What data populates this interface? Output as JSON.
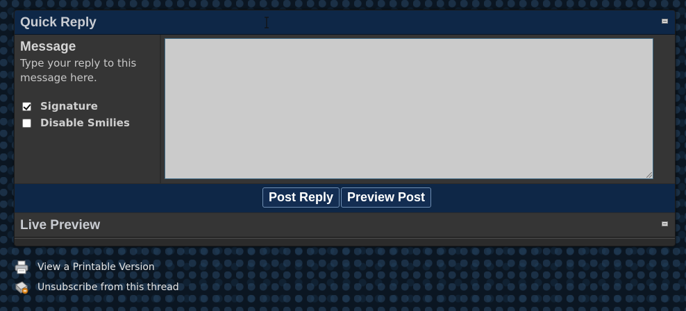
{
  "quick_reply": {
    "title": "Quick Reply",
    "message_title": "Message",
    "message_desc": "Type your reply to this message here.",
    "message_value": "",
    "options": [
      {
        "label": "Signature",
        "checked": true
      },
      {
        "label": "Disable Smilies",
        "checked": false
      }
    ],
    "buttons": {
      "post_reply": "Post Reply",
      "preview_post": "Preview Post"
    }
  },
  "live_preview": {
    "title": "Live Preview"
  },
  "links": [
    {
      "label": "View a Printable Version",
      "icon": "printer-icon"
    },
    {
      "label": "Unsubscribe from this thread",
      "icon": "unsubscribe-icon"
    }
  ],
  "colors": {
    "header_bg": "#0e2747",
    "panel_bg": "#353535",
    "textarea_bg": "#cbcbcb"
  }
}
